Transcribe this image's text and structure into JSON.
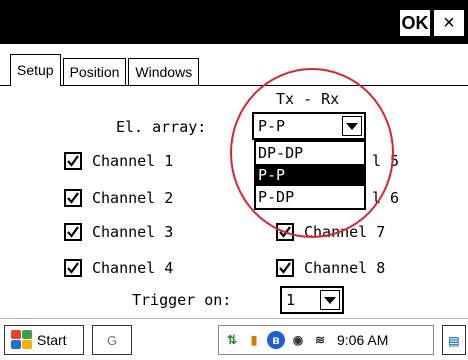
{
  "titlebar": {
    "ok_label": "OK",
    "close_label": "×"
  },
  "tabs": [
    {
      "label": "Setup",
      "active": true
    },
    {
      "label": "Position",
      "active": false
    },
    {
      "label": "Windows",
      "active": false
    }
  ],
  "tx_rx_header": "Tx - Rx",
  "el_array": {
    "label": "El. array:",
    "value": "P-P",
    "options": [
      "DP-DP",
      "P-P",
      "P-DP"
    ],
    "selected_option": "P-P"
  },
  "channels": [
    {
      "label": "Channel 1",
      "checked": true
    },
    {
      "label": "Channel 2",
      "checked": true
    },
    {
      "label": "Channel 3",
      "checked": true
    },
    {
      "label": "Channel 4",
      "checked": true
    },
    {
      "label": "Channel 5",
      "visible_text": "l 5",
      "checked": true
    },
    {
      "label": "Channel 6",
      "visible_text": "l 6",
      "checked": true
    },
    {
      "label": "Channel 7",
      "checked": true
    },
    {
      "label": "Channel 8",
      "checked": true
    }
  ],
  "trigger": {
    "label": "Trigger on:",
    "value": "1"
  },
  "taskbar": {
    "start_label": "Start",
    "task_item_label": "G",
    "clock": "9:06 AM",
    "tray_icons": [
      "connectivity-icon",
      "battery-icon",
      "bluetooth-icon",
      "volume-icon",
      "network-icon"
    ]
  },
  "colors": {
    "highlight_circle": "#d9262e",
    "selection": "#000000"
  }
}
